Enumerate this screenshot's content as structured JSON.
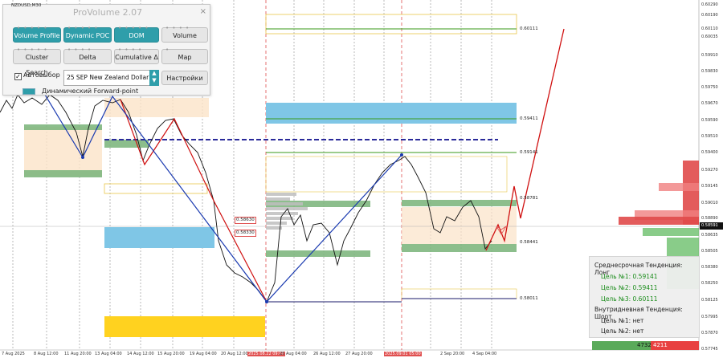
{
  "symbol": "NZDUSD,M30",
  "panel": {
    "title": "ProVolume 2.07",
    "close": "×",
    "buttons": [
      {
        "label": "Volume Profile",
        "active": true
      },
      {
        "label": "Dynamic POC",
        "active": true
      },
      {
        "label": "DOM",
        "active": true
      },
      {
        "label": "Volume",
        "active": false
      },
      {
        "label": "Cluster Search",
        "active": false
      },
      {
        "label": "Delta",
        "active": false
      },
      {
        "label": "Cumulative Δ",
        "active": false
      },
      {
        "label": "Map",
        "active": false
      }
    ],
    "auto_select_label": "Автовыбор",
    "auto_select_checked": true,
    "instrument_select": "25 SEP New Zealand Dollar",
    "settings_button": "Настройки",
    "forward_point_label": "Динамический Forward-point"
  },
  "price_axis": [
    "0.60290",
    "0.60190",
    "0.60110",
    "0.60035",
    "0.59910",
    "0.59830",
    "0.59750",
    "0.59670",
    "0.59590",
    "0.59510",
    "0.59400",
    "0.59270",
    "0.59145",
    "0.59010",
    "0.58890",
    "0.58760",
    "0.58635",
    "0.58591",
    "0.58505",
    "0.58380",
    "0.58250",
    "0.58125",
    "0.57995",
    "0.57870",
    "0.57745",
    "0.57620"
  ],
  "current_price": "0.58591",
  "time_axis": [
    "7 Aug 2025",
    "8 Aug 12:00",
    "11 Aug 20:00",
    "13 Aug 04:00",
    "14 Aug 12:00",
    "15 Aug 20:00",
    "19 Aug 04:00",
    "20 Aug 12:00",
    "2025.08.22 09:00",
    "25 Aug 04:00",
    "26 Aug 12:00",
    "27 Aug 20:00",
    "2025.09.01 05:00",
    "2 Sep 20:00",
    "4 Sep 04:00"
  ],
  "chart_tags": [
    "0.60111",
    "0.59411",
    "0.59141",
    "0.58781",
    "0.58441",
    "0.58011",
    "0.58630",
    "0.58330"
  ],
  "trend": {
    "medium_title": "Среднесрочная Тенденция: Лонг",
    "targets": [
      "Цель №1: 0.59141",
      "Цель №2: 0.59411",
      "Цель №3: 0.60111"
    ],
    "intraday_title": "Внутридневная Тенденция: Шорт",
    "intraday_targets": [
      "Цель №1: нет",
      "Цель №2: нет"
    ]
  },
  "volume_bar": {
    "buy": "4732",
    "sell": "4211"
  },
  "colors": {
    "buy": "#5aaa5a",
    "sell": "#e84040",
    "accent": "#2f9eaa"
  }
}
